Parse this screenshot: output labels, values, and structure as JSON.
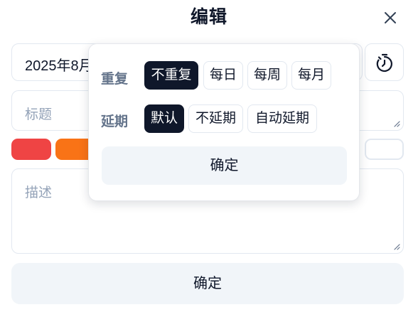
{
  "dialog": {
    "title": "编辑",
    "close_icon": "close-icon"
  },
  "form": {
    "date_value": "2025年8月",
    "timer_icon": "timer-icon",
    "title_placeholder": "标题",
    "description_placeholder": "描述",
    "confirm_label": "确定",
    "colors": [
      "#ef4444",
      "#f97316",
      "#ffffff"
    ]
  },
  "popover": {
    "repeat": {
      "label": "重复",
      "options": [
        "不重复",
        "每日",
        "每周",
        "每月"
      ],
      "selected": "不重复"
    },
    "postpone": {
      "label": "延期",
      "options": [
        "默认",
        "不延期",
        "自动延期"
      ],
      "selected": "默认"
    },
    "confirm_label": "确定"
  }
}
